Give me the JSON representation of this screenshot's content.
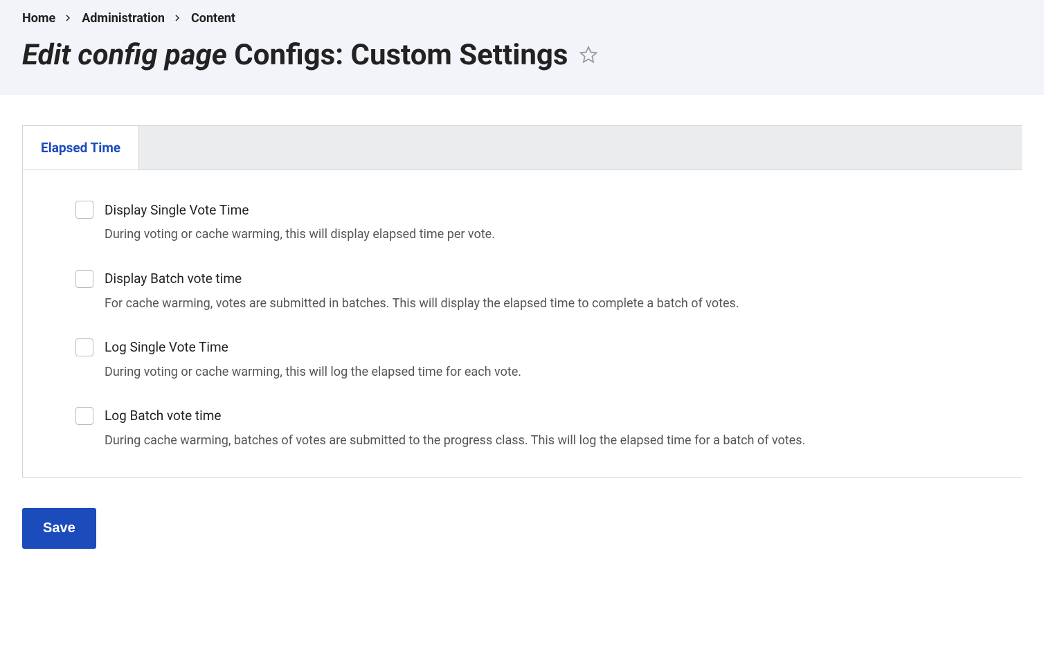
{
  "breadcrumb": {
    "items": [
      {
        "label": "Home"
      },
      {
        "label": "Administration"
      },
      {
        "label": "Content"
      }
    ]
  },
  "page": {
    "title_prefix": "Edit config page",
    "title_main": "Configs: Custom Settings"
  },
  "tabs": [
    {
      "label": "Elapsed Time"
    }
  ],
  "form": {
    "items": [
      {
        "label": "Display Single Vote Time",
        "description": "During voting or cache warming, this will display elapsed time per vote.",
        "checked": false
      },
      {
        "label": "Display Batch vote time",
        "description": "For cache warming, votes are submitted in batches. This will display the elapsed time to complete a batch of votes.",
        "checked": false
      },
      {
        "label": "Log Single Vote Time",
        "description": "During voting or cache warming, this will log the elapsed time for each vote.",
        "checked": false
      },
      {
        "label": "Log Batch vote time",
        "description": "During cache warming, batches of votes are submitted to the progress class. This will log the elapsed time for a batch of votes.",
        "checked": false
      }
    ]
  },
  "actions": {
    "save_label": "Save"
  }
}
